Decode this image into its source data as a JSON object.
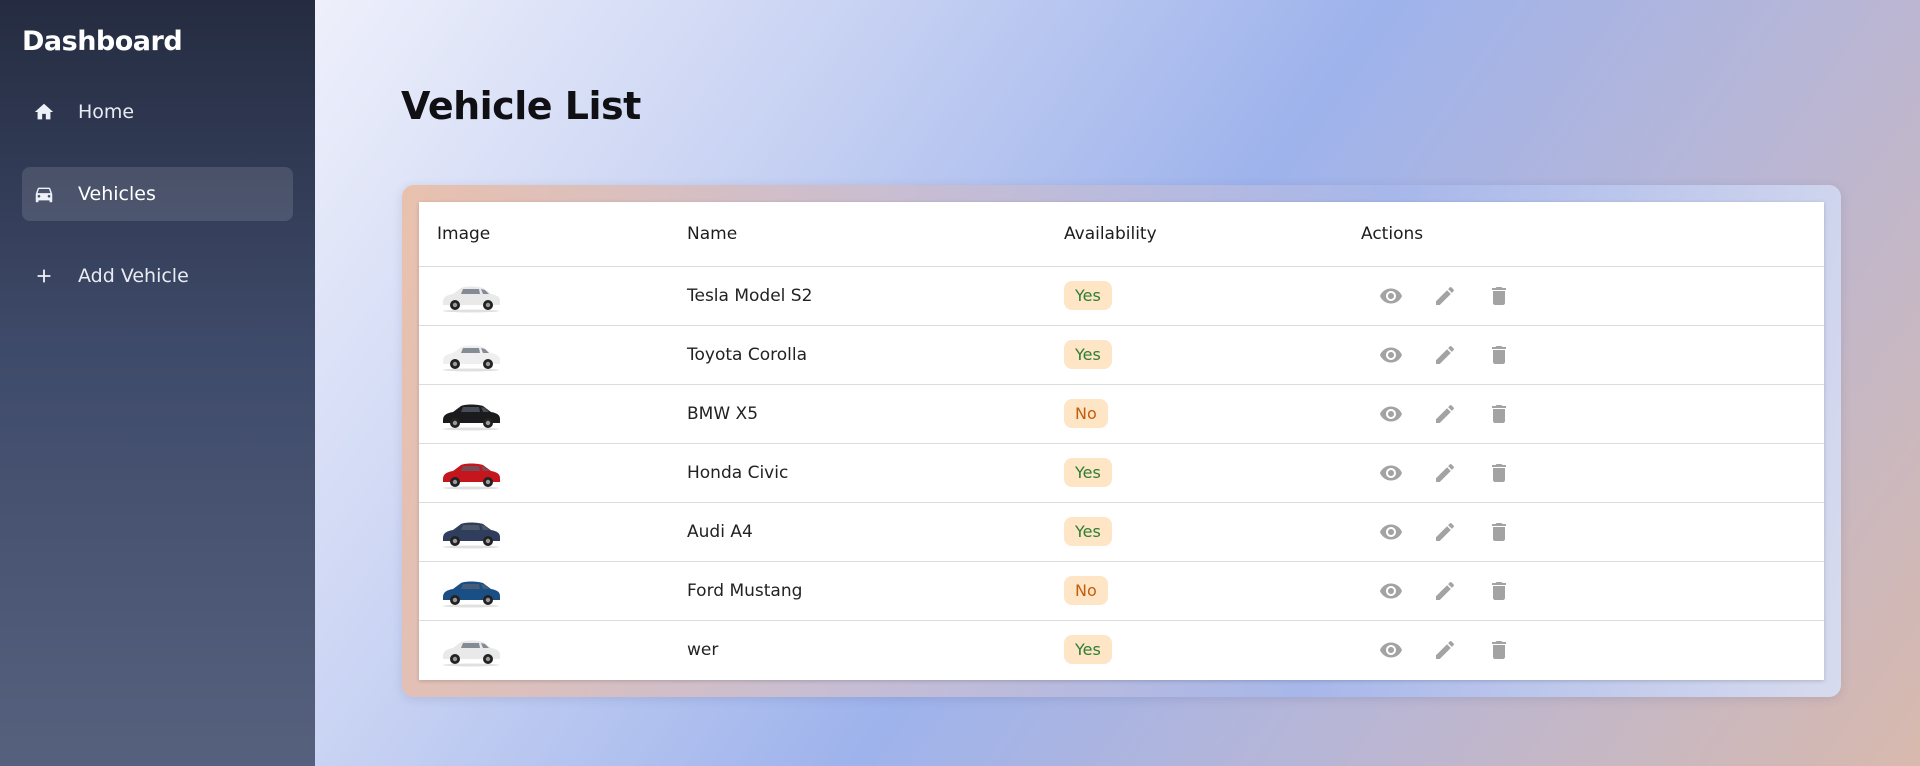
{
  "sidebar": {
    "brand": "Dashboard",
    "items": [
      {
        "label": "Home",
        "icon": "home-icon",
        "active": false
      },
      {
        "label": "Vehicles",
        "icon": "car-icon",
        "active": true
      },
      {
        "label": "Add Vehicle",
        "icon": "plus-icon",
        "active": false
      }
    ]
  },
  "main": {
    "title": "Vehicle List",
    "table": {
      "headers": [
        "Image",
        "Name",
        "Availability",
        "Actions"
      ],
      "rows": [
        {
          "name": "Tesla Model S2",
          "availability": "Yes",
          "car_color": "#e9e9ea"
        },
        {
          "name": "Toyota Corolla",
          "availability": "Yes",
          "car_color": "#efefef"
        },
        {
          "name": "BMW X5",
          "availability": "No",
          "car_color": "#1b1b1d"
        },
        {
          "name": "Honda Civic",
          "availability": "Yes",
          "car_color": "#c4161c"
        },
        {
          "name": "Audi A4",
          "availability": "Yes",
          "car_color": "#2f3e5c"
        },
        {
          "name": "Ford Mustang",
          "availability": "No",
          "car_color": "#1a4f86"
        },
        {
          "name": "wer",
          "availability": "Yes",
          "car_color": "#e9e9ea"
        }
      ]
    }
  },
  "colors": {
    "badge_bg": "#fde5c6",
    "yes_text": "#2e7d32",
    "no_text": "#c35d0a",
    "action_icon": "#a3a3a3"
  }
}
